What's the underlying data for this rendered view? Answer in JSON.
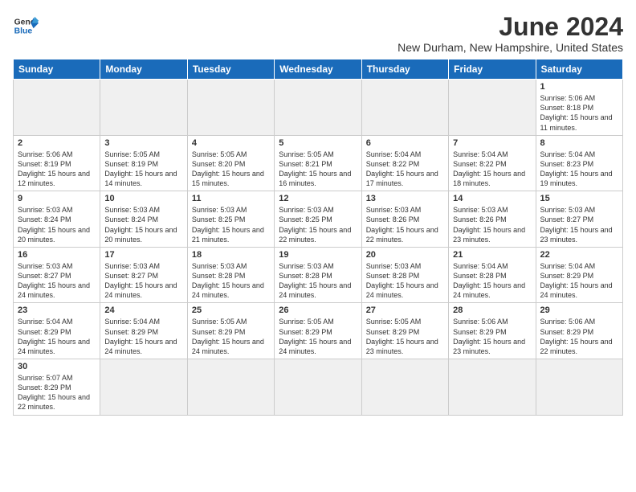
{
  "header": {
    "logo_general": "General",
    "logo_blue": "Blue",
    "month_title": "June 2024",
    "location": "New Durham, New Hampshire, United States"
  },
  "weekdays": [
    "Sunday",
    "Monday",
    "Tuesday",
    "Wednesday",
    "Thursday",
    "Friday",
    "Saturday"
  ],
  "days": {
    "1": {
      "num": "1",
      "sunrise": "5:06 AM",
      "sunset": "8:18 PM",
      "daylight": "15 hours and 11 minutes."
    },
    "2": {
      "num": "2",
      "sunrise": "5:06 AM",
      "sunset": "8:19 PM",
      "daylight": "15 hours and 12 minutes."
    },
    "3": {
      "num": "3",
      "sunrise": "5:05 AM",
      "sunset": "8:19 PM",
      "daylight": "15 hours and 14 minutes."
    },
    "4": {
      "num": "4",
      "sunrise": "5:05 AM",
      "sunset": "8:20 PM",
      "daylight": "15 hours and 15 minutes."
    },
    "5": {
      "num": "5",
      "sunrise": "5:05 AM",
      "sunset": "8:21 PM",
      "daylight": "15 hours and 16 minutes."
    },
    "6": {
      "num": "6",
      "sunrise": "5:04 AM",
      "sunset": "8:22 PM",
      "daylight": "15 hours and 17 minutes."
    },
    "7": {
      "num": "7",
      "sunrise": "5:04 AM",
      "sunset": "8:22 PM",
      "daylight": "15 hours and 18 minutes."
    },
    "8": {
      "num": "8",
      "sunrise": "5:04 AM",
      "sunset": "8:23 PM",
      "daylight": "15 hours and 19 minutes."
    },
    "9": {
      "num": "9",
      "sunrise": "5:03 AM",
      "sunset": "8:24 PM",
      "daylight": "15 hours and 20 minutes."
    },
    "10": {
      "num": "10",
      "sunrise": "5:03 AM",
      "sunset": "8:24 PM",
      "daylight": "15 hours and 20 minutes."
    },
    "11": {
      "num": "11",
      "sunrise": "5:03 AM",
      "sunset": "8:25 PM",
      "daylight": "15 hours and 21 minutes."
    },
    "12": {
      "num": "12",
      "sunrise": "5:03 AM",
      "sunset": "8:25 PM",
      "daylight": "15 hours and 22 minutes."
    },
    "13": {
      "num": "13",
      "sunrise": "5:03 AM",
      "sunset": "8:26 PM",
      "daylight": "15 hours and 22 minutes."
    },
    "14": {
      "num": "14",
      "sunrise": "5:03 AM",
      "sunset": "8:26 PM",
      "daylight": "15 hours and 23 minutes."
    },
    "15": {
      "num": "15",
      "sunrise": "5:03 AM",
      "sunset": "8:27 PM",
      "daylight": "15 hours and 23 minutes."
    },
    "16": {
      "num": "16",
      "sunrise": "5:03 AM",
      "sunset": "8:27 PM",
      "daylight": "15 hours and 24 minutes."
    },
    "17": {
      "num": "17",
      "sunrise": "5:03 AM",
      "sunset": "8:27 PM",
      "daylight": "15 hours and 24 minutes."
    },
    "18": {
      "num": "18",
      "sunrise": "5:03 AM",
      "sunset": "8:28 PM",
      "daylight": "15 hours and 24 minutes."
    },
    "19": {
      "num": "19",
      "sunrise": "5:03 AM",
      "sunset": "8:28 PM",
      "daylight": "15 hours and 24 minutes."
    },
    "20": {
      "num": "20",
      "sunrise": "5:03 AM",
      "sunset": "8:28 PM",
      "daylight": "15 hours and 24 minutes."
    },
    "21": {
      "num": "21",
      "sunrise": "5:04 AM",
      "sunset": "8:28 PM",
      "daylight": "15 hours and 24 minutes."
    },
    "22": {
      "num": "22",
      "sunrise": "5:04 AM",
      "sunset": "8:29 PM",
      "daylight": "15 hours and 24 minutes."
    },
    "23": {
      "num": "23",
      "sunrise": "5:04 AM",
      "sunset": "8:29 PM",
      "daylight": "15 hours and 24 minutes."
    },
    "24": {
      "num": "24",
      "sunrise": "5:04 AM",
      "sunset": "8:29 PM",
      "daylight": "15 hours and 24 minutes."
    },
    "25": {
      "num": "25",
      "sunrise": "5:05 AM",
      "sunset": "8:29 PM",
      "daylight": "15 hours and 24 minutes."
    },
    "26": {
      "num": "26",
      "sunrise": "5:05 AM",
      "sunset": "8:29 PM",
      "daylight": "15 hours and 24 minutes."
    },
    "27": {
      "num": "27",
      "sunrise": "5:05 AM",
      "sunset": "8:29 PM",
      "daylight": "15 hours and 23 minutes."
    },
    "28": {
      "num": "28",
      "sunrise": "5:06 AM",
      "sunset": "8:29 PM",
      "daylight": "15 hours and 23 minutes."
    },
    "29": {
      "num": "29",
      "sunrise": "5:06 AM",
      "sunset": "8:29 PM",
      "daylight": "15 hours and 22 minutes."
    },
    "30": {
      "num": "30",
      "sunrise": "5:07 AM",
      "sunset": "8:29 PM",
      "daylight": "15 hours and 22 minutes."
    }
  }
}
